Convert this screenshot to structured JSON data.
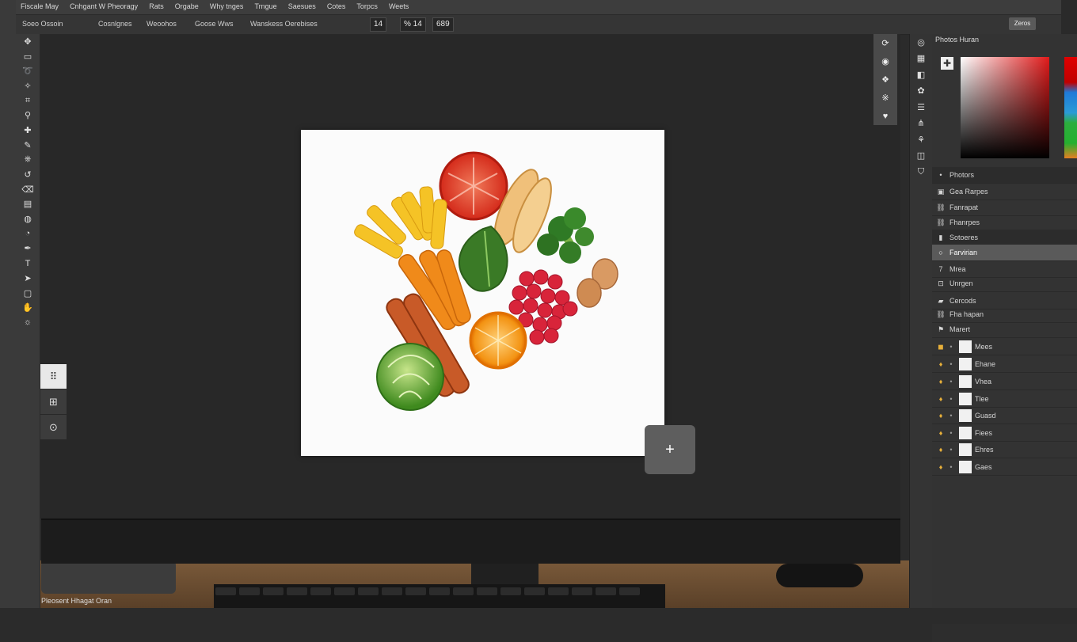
{
  "menubar": {
    "items": [
      "Fiscale May",
      "Cnhgant W Pheoragy",
      "Rats",
      "Orgabe",
      "Why tnges",
      "Trngue",
      "Saesues",
      "Cotes",
      "Torpcs",
      "Weets"
    ]
  },
  "options": {
    "items": [
      "Soeo Ossoin",
      "Cosnlgnes",
      "Weoohos",
      "Goose Wws",
      "Wanskess Oerebises"
    ],
    "field1": "14",
    "field2": "% 14",
    "field3": "689",
    "right_button": "Zeros"
  },
  "toolbar": {
    "tools": [
      "move-icon",
      "marquee-icon",
      "lasso-icon",
      "magic-wand-icon",
      "crop-icon",
      "eyedropper-icon",
      "healing-icon",
      "brush-icon",
      "stamp-icon",
      "history-brush-icon",
      "eraser-icon",
      "gradient-icon",
      "blur-icon",
      "dodge-icon",
      "pen-icon",
      "type-icon",
      "path-select-icon",
      "shape-icon",
      "hand-icon",
      "zoom-icon"
    ]
  },
  "float_tools": {
    "labels": [
      "⠿",
      "⊞",
      "⊙"
    ]
  },
  "add_button": {
    "label": "+"
  },
  "panel": {
    "title": "Photos Huran",
    "rows": [
      {
        "label": "Photors",
        "type": "hdr"
      },
      {
        "label": "Gea Rarpes",
        "type": "item"
      },
      {
        "label": "Fanrapat",
        "type": "item"
      },
      {
        "label": "Fhanrpes",
        "type": "item"
      },
      {
        "label": "Sotoeres",
        "type": "hdr"
      },
      {
        "label": "Farvirian",
        "type": "sel"
      },
      {
        "label": "Mrea",
        "type": "item"
      },
      {
        "label": "Unrgen",
        "type": "item"
      },
      {
        "label": "Cercods",
        "type": "item"
      },
      {
        "label": "Fha hapan",
        "type": "item"
      },
      {
        "label": "Marert",
        "type": "item"
      },
      {
        "label": "Mees",
        "type": "layer"
      },
      {
        "label": "Ehane",
        "type": "layer"
      },
      {
        "label": "Vhea",
        "type": "layer"
      },
      {
        "label": "Tlee",
        "type": "layer"
      },
      {
        "label": "Guasd",
        "type": "layer"
      },
      {
        "label": "Fiees",
        "type": "layer"
      },
      {
        "label": "Ehres",
        "type": "layer"
      },
      {
        "label": "Gaes",
        "type": "layer"
      }
    ]
  },
  "status": {
    "text": "Pleosent Hhagat Oran"
  },
  "colors": {
    "accent": "#e8b03a",
    "panel": "#333333",
    "workspace": "#282828"
  }
}
